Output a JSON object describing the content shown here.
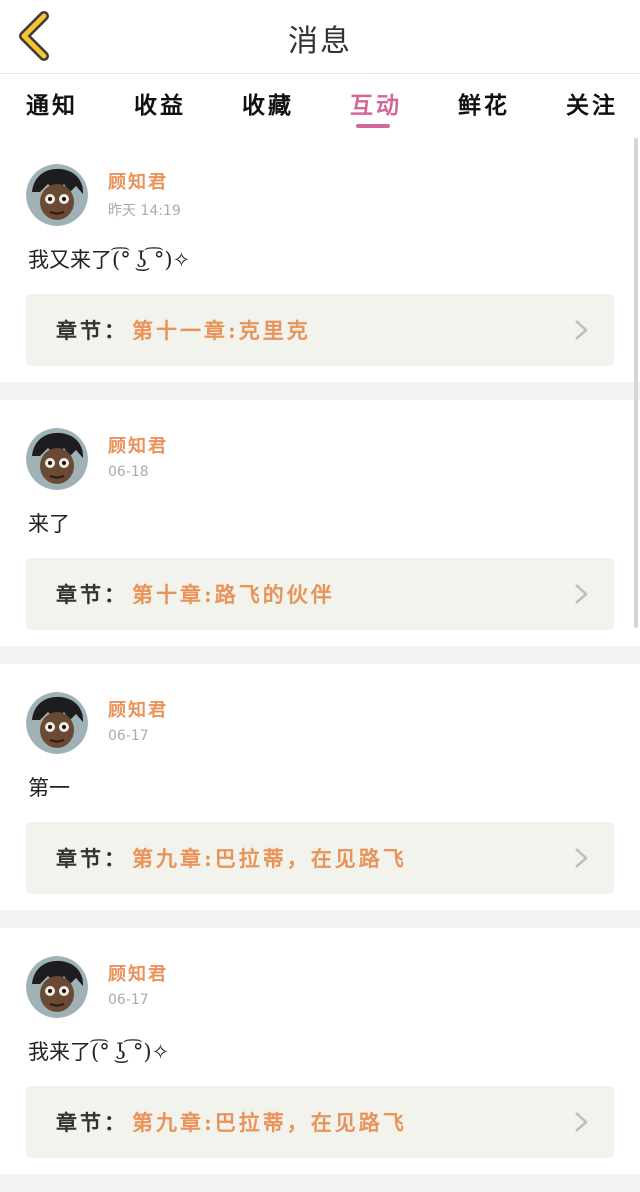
{
  "header": {
    "title": "消息",
    "back_icon": "chevron-left-icon"
  },
  "tabs": [
    {
      "label": "通知",
      "active": false
    },
    {
      "label": "收益",
      "active": false
    },
    {
      "label": "收藏",
      "active": false
    },
    {
      "label": "互动",
      "active": true
    },
    {
      "label": "鲜花",
      "active": false
    },
    {
      "label": "关注",
      "active": false
    }
  ],
  "colors": {
    "accent": "#d4679a",
    "username": "#e8935a",
    "chapter_title": "#e8935a",
    "chapter_bg": "#f3f3ee"
  },
  "messages": [
    {
      "username": "顾知君",
      "time": "昨天 14:19",
      "text": "我又来了(͡° ͜ʖ ͡°)✧",
      "chapter_label": "章节：",
      "chapter_title": "第十一章:克里克"
    },
    {
      "username": "顾知君",
      "time": "06-18",
      "text": "来了",
      "chapter_label": "章节：",
      "chapter_title": "第十章:路飞的伙伴"
    },
    {
      "username": "顾知君",
      "time": "06-17",
      "text": "第一",
      "chapter_label": "章节：",
      "chapter_title": "第九章:巴拉蒂，在见路飞"
    },
    {
      "username": "顾知君",
      "time": "06-17",
      "text": "我来了(͡° ͜ʖ ͡°)✧",
      "chapter_label": "章节：",
      "chapter_title": "第九章:巴拉蒂，在见路飞"
    }
  ]
}
